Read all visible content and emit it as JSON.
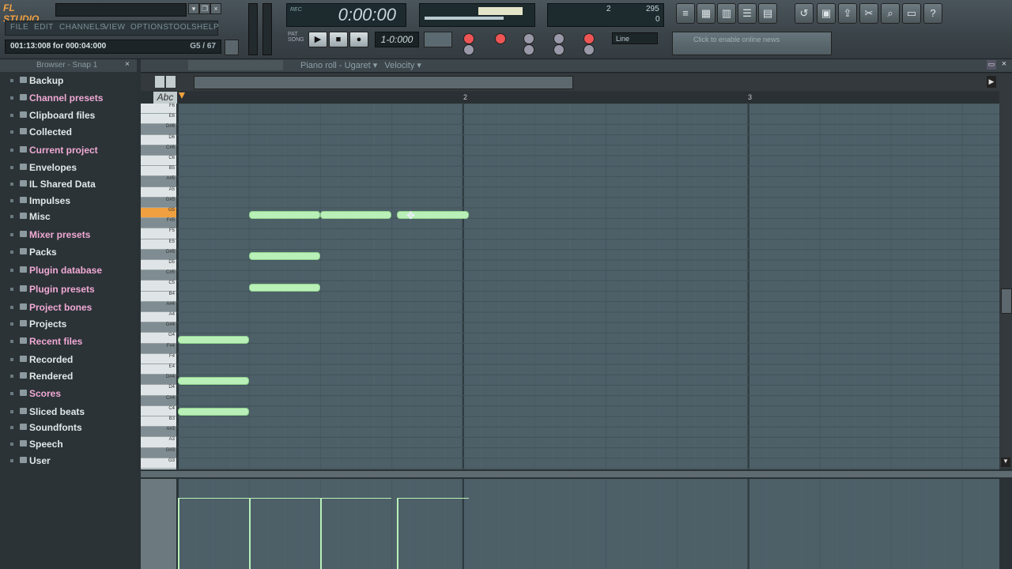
{
  "app": {
    "title": "FL STUDIO"
  },
  "menu": [
    "FILE",
    "EDIT",
    "CHANNELS",
    "VIEW",
    "OPTIONS",
    "TOOLS",
    "HELP"
  ],
  "hint": {
    "left": "001:13:008 for 000:04:000",
    "right": "G5 / 67"
  },
  "time": {
    "value": "0:00:00"
  },
  "pattern": {
    "display": "1-0:000"
  },
  "cpu": {
    "ram": "295",
    "poly": "0",
    "count": "2"
  },
  "snap": {
    "value": "Line"
  },
  "news": {
    "text": "Click to enable online news"
  },
  "browser": {
    "title": "Browser - Snap 1",
    "items": [
      "Backup",
      "Channel presets",
      "Clipboard files",
      "Collected",
      "Current project",
      "Envelopes",
      "IL Shared Data",
      "Impulses",
      "Misc",
      "Mixer presets",
      "Packs",
      "Plugin database",
      "Plugin presets",
      "Project bones",
      "Projects",
      "Recent files",
      "Recorded",
      "Rendered",
      "Scores",
      "Sliced beats",
      "Soundfonts",
      "Speech",
      "User"
    ]
  },
  "piano_roll": {
    "title": "Piano roll - Ugaret",
    "target": "Velocity",
    "ruler": [
      "2",
      "3"
    ],
    "abc": "Abc",
    "keys": [
      "F6",
      "E6",
      "D#6",
      "D6",
      "C#6",
      "C6",
      "B5",
      "A#5",
      "A5",
      "G#5",
      "G5",
      "F#5",
      "F5",
      "E5",
      "D#5",
      "D5",
      "C#5",
      "C5",
      "B4",
      "A#4",
      "A4",
      "G#4",
      "G4",
      "F#4",
      "F4",
      "E4",
      "D#4",
      "D4",
      "C#4",
      "C4",
      "B3",
      "A#3",
      "A3",
      "G#3",
      "G3"
    ]
  },
  "colors": {
    "note": "#b9f0b8",
    "highlight_key": "#f0a040",
    "grid": "#4d6068"
  }
}
